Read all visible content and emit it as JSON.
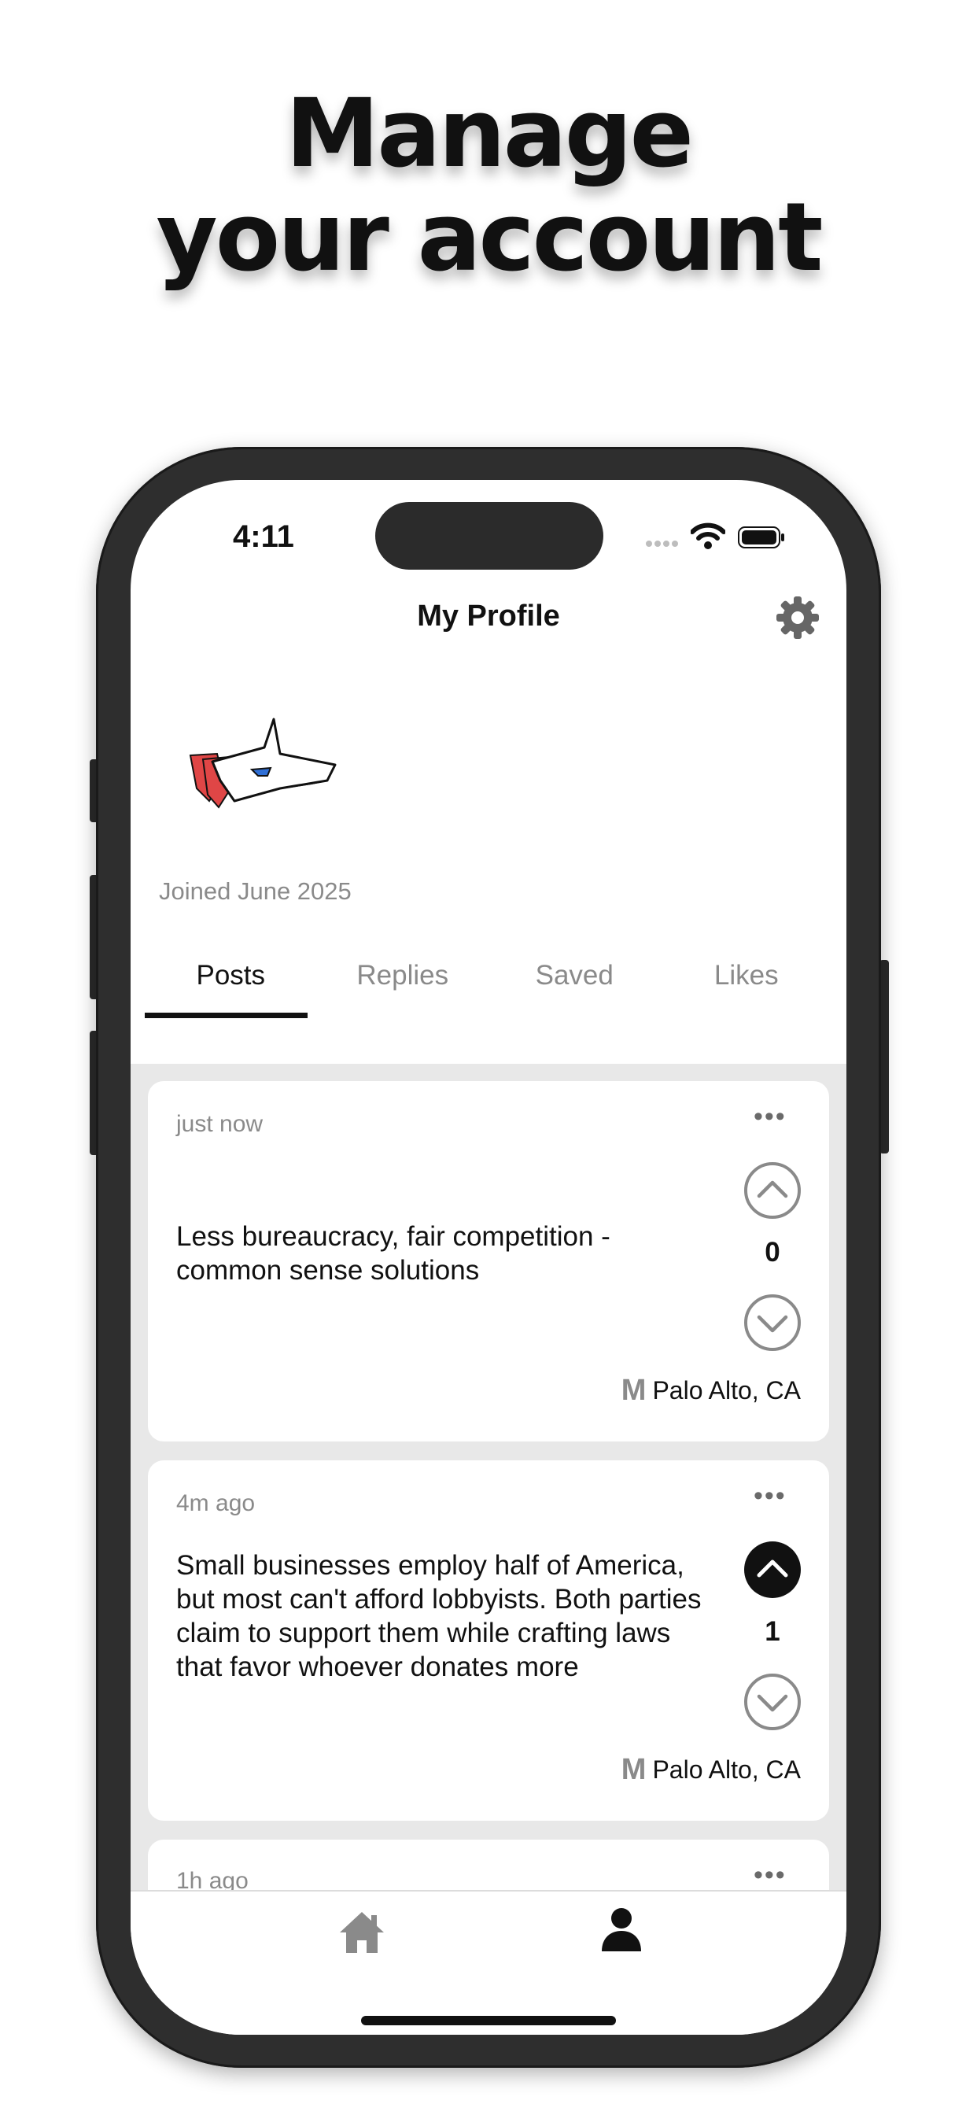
{
  "headline": {
    "line1": "Manage",
    "line2": "your account"
  },
  "status_bar": {
    "time": "4:11"
  },
  "header": {
    "title": "My Profile"
  },
  "profile": {
    "joined": "Joined June 2025"
  },
  "tabs": [
    {
      "label": "Posts",
      "active": true
    },
    {
      "label": "Replies",
      "active": false
    },
    {
      "label": "Saved",
      "active": false
    },
    {
      "label": "Likes",
      "active": false
    }
  ],
  "posts": [
    {
      "time": "just now",
      "text": "Less bureaucracy, fair competition - common sense solutions",
      "votes": "0",
      "upvoted": false,
      "location_badge": "M",
      "location": "Palo Alto, CA"
    },
    {
      "time": "4m ago",
      "text": "Small businesses employ half of America, but most can't afford lobbyists. Both parties claim to support them while crafting laws that favor whoever donates more",
      "votes": "1",
      "upvoted": true,
      "location_badge": "M",
      "location": "Palo Alto, CA"
    },
    {
      "time": "1h ago"
    }
  ],
  "more_glyph": "•••",
  "icons": {
    "settings": "gear-icon",
    "home": "home-icon",
    "profile": "person-icon",
    "upvote": "chevron-up-icon",
    "downvote": "chevron-down-icon"
  },
  "colors": {
    "text": "#111111",
    "muted": "#8a8a8a",
    "feed_bg": "#e8e8e8",
    "avatar_red": "#e04646",
    "avatar_blue": "#2f6fd6"
  }
}
